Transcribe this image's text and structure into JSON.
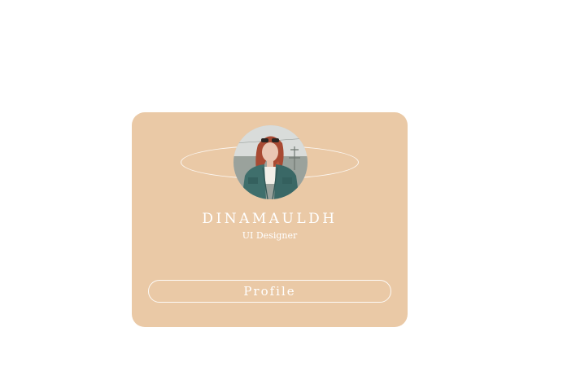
{
  "colors": {
    "card_background": "#eac9a6",
    "text": "#ffffff",
    "outline": "#ffffff"
  },
  "profile_card": {
    "name": "DINAMAULDH",
    "role": "UI Designer",
    "button_label": "Profile",
    "avatar_icon": "profile-photo"
  }
}
